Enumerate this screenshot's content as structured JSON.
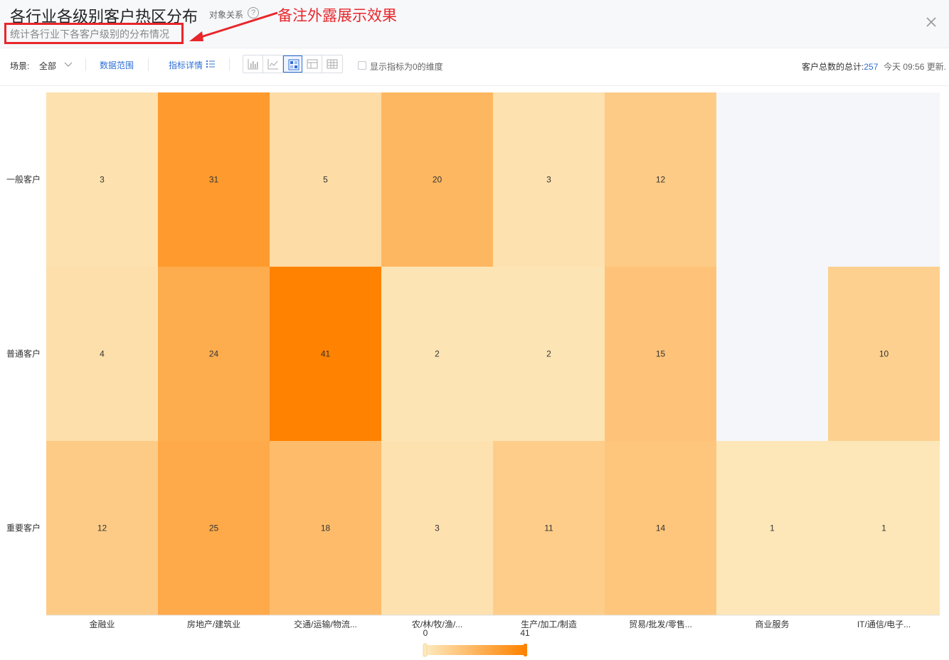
{
  "header": {
    "title": "各行业各级别客户热区分布",
    "relation_label": "对象关系",
    "help": "?",
    "annotation": "备注外露展示效果",
    "subtitle": "统计各行业下各客户级别的分布情况"
  },
  "toolbar": {
    "scene_label": "场景:",
    "scene_value": "全部",
    "data_range": "数据范围",
    "indicator_detail": "指标详情",
    "show_zero_label": "显示指标为0的维度",
    "total_label": "客户总数的总计:",
    "total_value": "257",
    "updated": "今天 09:56 更新."
  },
  "colors": {
    "accent": "#2f6fd6",
    "annotation": "#e8262b",
    "heat_low": "#fde9bd",
    "heat_high": "#ff8200",
    "empty": "#f5f6fa"
  },
  "chart_data": {
    "type": "heatmap",
    "x": [
      "金融业",
      "房地产/建筑业",
      "交通/运输/物流...",
      "农/林/牧/渔/...",
      "生产/加工/制造",
      "贸易/批发/零售...",
      "商业服务",
      "IT/通信/电子..."
    ],
    "y": [
      "一般客户",
      "普通客户",
      "重要客户"
    ],
    "values": [
      [
        3,
        31,
        5,
        20,
        3,
        12,
        null,
        null
      ],
      [
        4,
        24,
        41,
        2,
        2,
        15,
        null,
        10
      ],
      [
        12,
        25,
        18,
        3,
        11,
        14,
        1,
        1
      ]
    ],
    "visual_map": {
      "min": 0,
      "max": 41,
      "min_label": "0",
      "max_label": "41"
    }
  }
}
